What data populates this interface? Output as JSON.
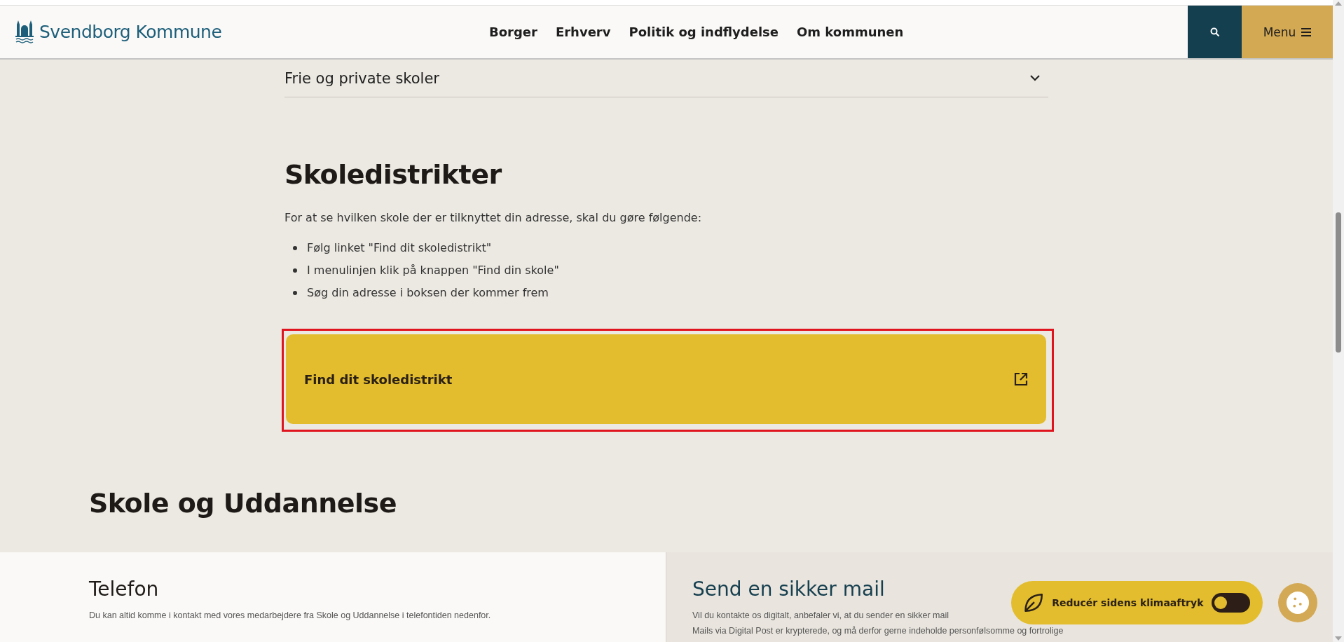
{
  "header": {
    "logo": "Svendborg Kommune",
    "nav": [
      "Borger",
      "Erhverv",
      "Politik og indflydelse",
      "Om kommunen"
    ],
    "menu_label": "Menu"
  },
  "accordion": [
    {
      "title": "Frie og private skoler",
      "expanded": false
    }
  ],
  "section": {
    "heading": "Skoledistrikter",
    "intro": "For at se hvilken skole der er tilknyttet din adresse, skal du gøre følgende:",
    "steps": [
      "Følg linket \"Find dit skoledistrikt\"",
      "I menulinjen klik på knappen \"Find din skole\"",
      "Søg din adresse i boksen der kommer frem"
    ],
    "link": {
      "label": "Find dit skoledistrikt",
      "highlighted": true
    }
  },
  "contact": {
    "heading": "Skole og Uddannelse",
    "cards": [
      {
        "kind": "phone",
        "title": "Telefon",
        "lines": [
          "Du kan altid komme i kontakt med vores medarbejdere fra Skole og Uddannelse i telefontiden nedenfor."
        ]
      },
      {
        "kind": "mail",
        "title": "Send en sikker mail",
        "lines": [
          "Vil du kontakte os digitalt, anbefaler vi, at du sender en sikker mail",
          "Mails via Digital Post er krypterede, og må derfor gerne indeholde personfølsomme og fortrolige"
        ]
      }
    ]
  },
  "climate_toggle": {
    "label": "Reducér sidens klimaaftryk",
    "on": false
  }
}
